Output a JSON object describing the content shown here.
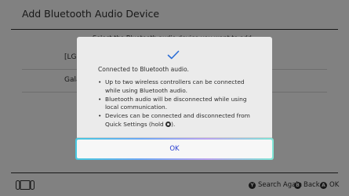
{
  "header": {
    "title": "Add Bluetooth Audio Device"
  },
  "background": {
    "subtitle": "Select the Bluetooth audio device you want to add.",
    "devices": [
      {
        "label": "[LG]"
      },
      {
        "label": "Gala"
      }
    ]
  },
  "dialog": {
    "icon": "checkmark-icon",
    "title": "Connected to Bluetooth audio.",
    "bullets": [
      "Up to two wireless controllers can be connected while using Bluetooth audio.",
      "Bluetooth audio will be disconnected while using local communication.",
      "Devices can be connected and disconnected from Quick Settings (hold"
    ],
    "bullet_suffix": ").",
    "ok_label": "OK"
  },
  "footer": {
    "icon": "switch-console-icon",
    "hints": [
      {
        "glyph": "Y",
        "label": "Search Again"
      },
      {
        "glyph": "B",
        "label": "Back"
      },
      {
        "glyph": "A",
        "label": "OK"
      }
    ]
  },
  "colors": {
    "accent": "#2a3fd1",
    "check": "#2a6dd6",
    "background": "#ebebeb",
    "text": "#2d2d2d"
  }
}
